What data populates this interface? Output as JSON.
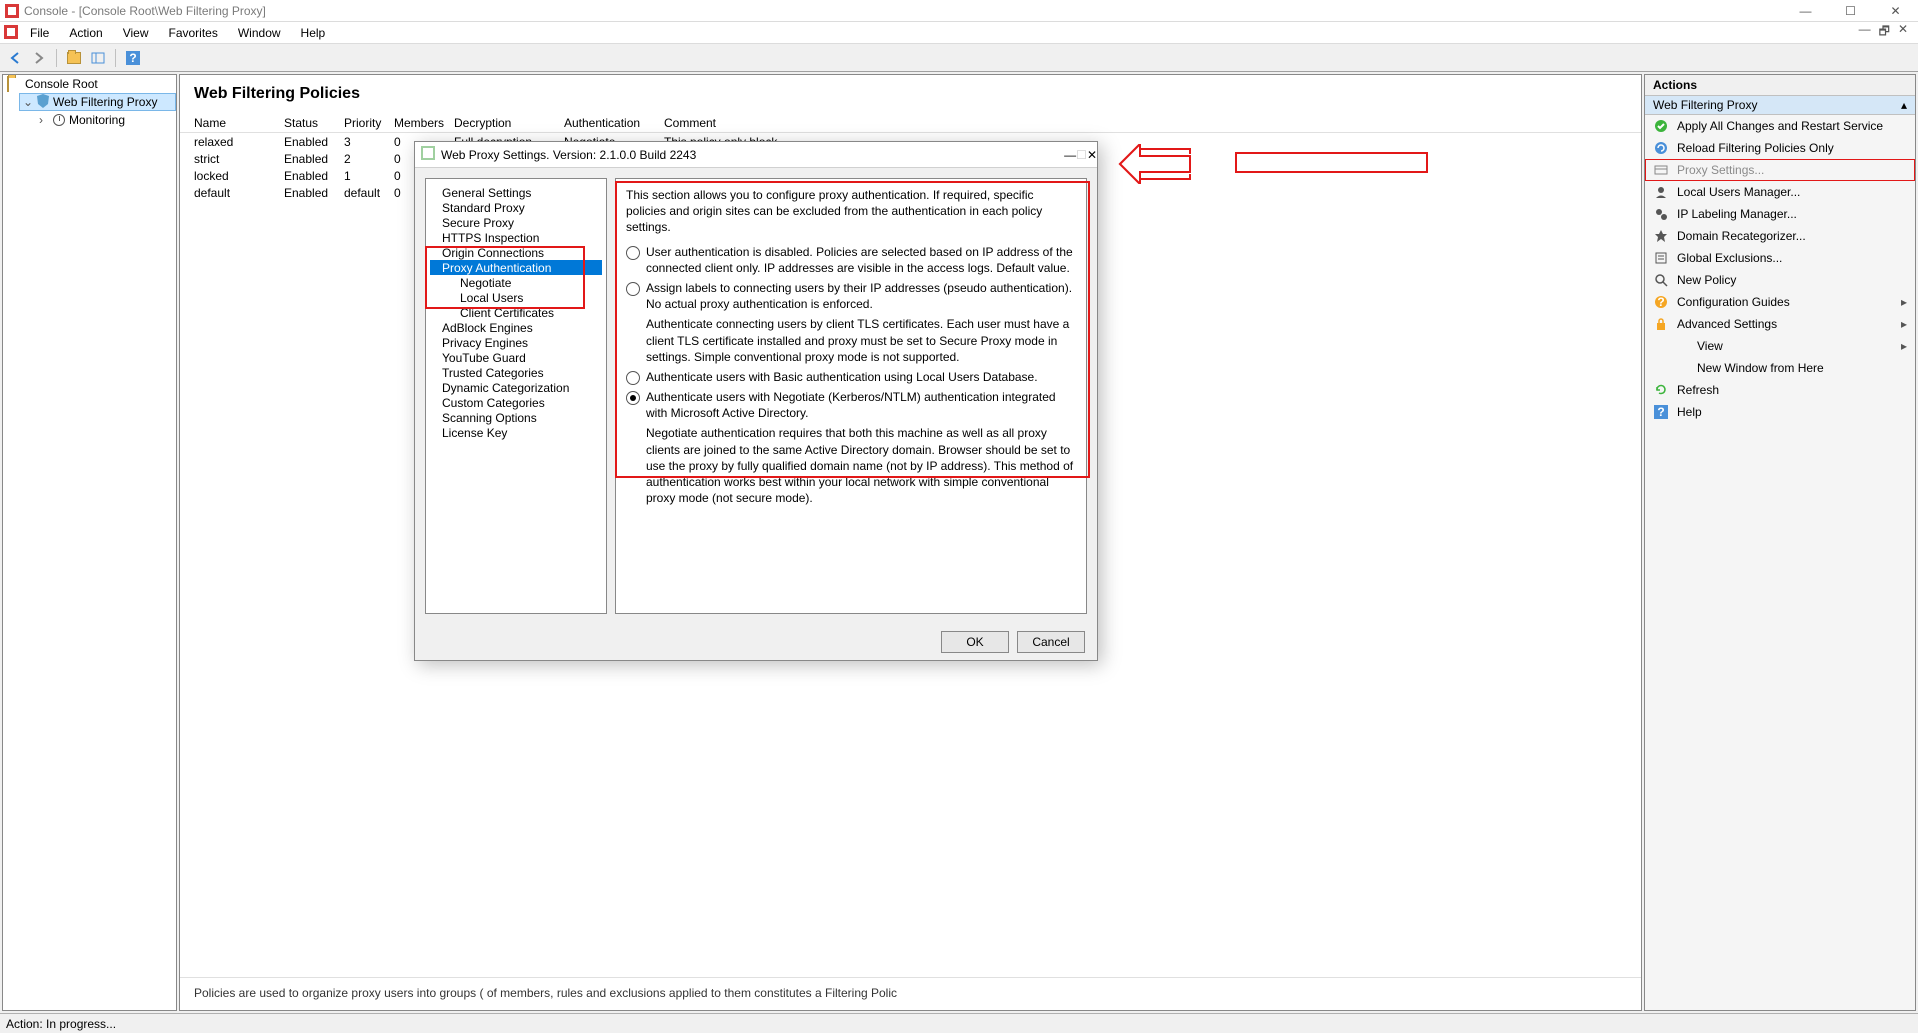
{
  "window": {
    "title": "Console - [Console Root\\Web Filtering Proxy]"
  },
  "menu": [
    "File",
    "Action",
    "View",
    "Favorites",
    "Window",
    "Help"
  ],
  "tree": {
    "root": "Console Root",
    "node1": "Web Filtering Proxy",
    "node2": "Monitoring"
  },
  "content": {
    "title": "Web Filtering Policies",
    "columns": [
      "Name",
      "Status",
      "Priority",
      "Members",
      "Decryption",
      "Authentication",
      "Comment"
    ],
    "rows": [
      {
        "name": "relaxed",
        "status": "Enabled",
        "priority": "3",
        "members": "0",
        "dec": "Full decryption",
        "auth": "Negotiate",
        "comment": "This policy only block..."
      },
      {
        "name": "strict",
        "status": "Enabled",
        "priority": "2",
        "members": "0",
        "dec": "",
        "auth": "",
        "comment": ""
      },
      {
        "name": "locked",
        "status": "Enabled",
        "priority": "1",
        "members": "0",
        "dec": "",
        "auth": "",
        "comment": ""
      },
      {
        "name": "default",
        "status": "Enabled",
        "priority": "default",
        "members": "0",
        "dec": "",
        "auth": "",
        "comment": ""
      }
    ],
    "footer": "Policies are used to organize proxy users into groups (                                                                                                                                                                   of members, rules and exclusions applied to them constitutes a Filtering Polic"
  },
  "actions": {
    "title": "Actions",
    "section": "Web Filtering Proxy",
    "items": [
      {
        "label": "Apply All Changes and Restart Service",
        "icon": "check-green"
      },
      {
        "label": "Reload Filtering Policies Only",
        "icon": "reload-blue"
      },
      {
        "label": "Proxy Settings...",
        "icon": "settings",
        "disabled": true,
        "highlight": true
      },
      {
        "label": "Local Users Manager...",
        "icon": "user"
      },
      {
        "label": "IP Labeling Manager...",
        "icon": "iplabel"
      },
      {
        "label": "Domain Recategorizer...",
        "icon": "star"
      },
      {
        "label": "Global Exclusions...",
        "icon": "list"
      },
      {
        "label": "New Policy",
        "icon": "search"
      },
      {
        "label": "Configuration Guides",
        "icon": "help-badge",
        "submenu": true
      },
      {
        "label": "Advanced Settings",
        "icon": "lock",
        "submenu": true
      },
      {
        "label": "View",
        "submenu": true,
        "indent": true
      },
      {
        "label": "New Window from Here",
        "indent": true
      },
      {
        "label": "Refresh",
        "icon": "refresh"
      },
      {
        "label": "Help",
        "icon": "help"
      }
    ]
  },
  "dialog": {
    "title": "Web Proxy Settings. Version: 2.1.0.0 Build 2243",
    "tree": [
      {
        "label": "General Settings"
      },
      {
        "label": "Standard Proxy"
      },
      {
        "label": "Secure Proxy"
      },
      {
        "label": "HTTPS Inspection"
      },
      {
        "label": "Origin Connections"
      },
      {
        "label": "Proxy Authentication",
        "selected": true
      },
      {
        "label": "Negotiate",
        "child": true
      },
      {
        "label": "Local Users",
        "child": true
      },
      {
        "label": "Client Certificates",
        "child": true
      },
      {
        "label": "AdBlock Engines"
      },
      {
        "label": "Privacy Engines"
      },
      {
        "label": "YouTube Guard"
      },
      {
        "label": "Trusted Categories"
      },
      {
        "label": "Dynamic Categorization"
      },
      {
        "label": "Custom Categories"
      },
      {
        "label": "Scanning Options"
      },
      {
        "label": "License Key"
      }
    ],
    "intro": "This section allows you to configure proxy authentication.  If required, specific policies and origin sites can be excluded from the authentication in each policy settings.",
    "options": [
      {
        "text": "User authentication is disabled. Policies are selected based on IP address of the connected client only. IP addresses are visible in the access logs. Default value."
      },
      {
        "text": "Assign labels to connecting users by their IP addresses (pseudo authentication). No actual proxy authentication is enforced."
      },
      {
        "text": "Authenticate connecting users by client TLS certificates. Each user must have a client TLS certificate installed and proxy must be set to Secure Proxy mode in settings. Simple conventional proxy mode is not supported.",
        "noradio": true
      },
      {
        "text": "Authenticate users with Basic authentication using Local Users Database."
      },
      {
        "text": "Authenticate users with Negotiate (Kerberos/NTLM) authentication integrated with Microsoft Active Directory.",
        "selected": true
      }
    ],
    "note": "Negotiate authentication requires that both this machine as well as all proxy clients are joined to the same Active Directory domain. Browser should be set to use the proxy by fully qualified domain name (not by IP address). This method of authentication works best within your local network with simple conventional proxy mode (not secure mode).",
    "ok": "OK",
    "cancel": "Cancel"
  },
  "status": "Action:  In progress..."
}
